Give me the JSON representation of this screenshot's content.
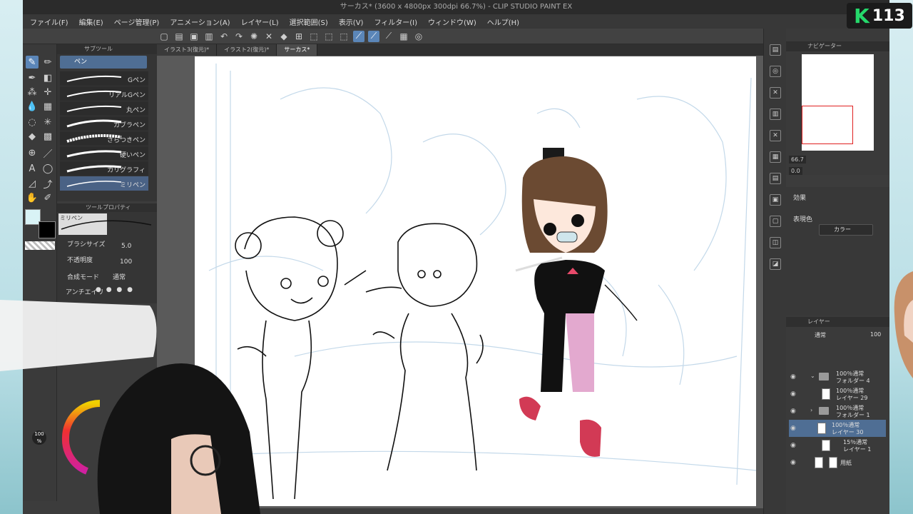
{
  "app": {
    "title": "サーカス* (3600 x 4800px 300dpi 66.7%) - CLIP STUDIO PAINT EX"
  },
  "overlay": {
    "logo_letter": "K",
    "logo_number": "113"
  },
  "menu": [
    "ファイル(F)",
    "編集(E)",
    "ページ管理(P)",
    "アニメーション(A)",
    "レイヤー(L)",
    "選択範囲(S)",
    "表示(V)",
    "フィルター(I)",
    "ウィンドウ(W)",
    "ヘルプ(H)"
  ],
  "doc_tabs": [
    "イラスト3(復元)*",
    "イラスト2(復元)*",
    "サーカス*"
  ],
  "subtool": {
    "panel_title": "サブツール",
    "group_label": "ペン",
    "brushes": [
      "Gペン",
      "リアルGペン",
      "丸ペン",
      "カブラペン",
      "さらつきペン",
      "硬いペン",
      "カリグラフィ",
      "ミリペン"
    ],
    "selected_index": 7
  },
  "tool_property": {
    "panel_title": "ツールプロパティ",
    "brush_name": "ミリペン",
    "brush_size_label": "ブラシサイズ",
    "brush_size_value": "5.0",
    "opacity_label": "不透明度",
    "opacity_value": "100",
    "blend_label": "合成モード",
    "blend_value": "通常",
    "antialias_label": "アンチエイリ"
  },
  "navigator": {
    "panel_title": "ナビゲーター",
    "zoom": "66.7",
    "rotation": "0.0"
  },
  "properties": {
    "effect_label": "効果",
    "display_color_label": "表現色",
    "display_color_value": "カラー"
  },
  "layers": {
    "panel_title": "レイヤー",
    "blend": "通常",
    "opacity": "100",
    "items": [
      {
        "line1": "100％通常",
        "line2": "フォルダー 4"
      },
      {
        "line1": "100％通常",
        "line2": "レイヤー 29"
      },
      {
        "line1": "100％通常",
        "line2": "フォルダー 1"
      },
      {
        "line1": "100％通常",
        "line2": "レイヤー 30"
      },
      {
        "line1": "15％通常",
        "line2": "レイヤー 1"
      },
      {
        "line1": "",
        "line2": "用紙"
      }
    ]
  },
  "brush_size_indicator": "100\n%"
}
